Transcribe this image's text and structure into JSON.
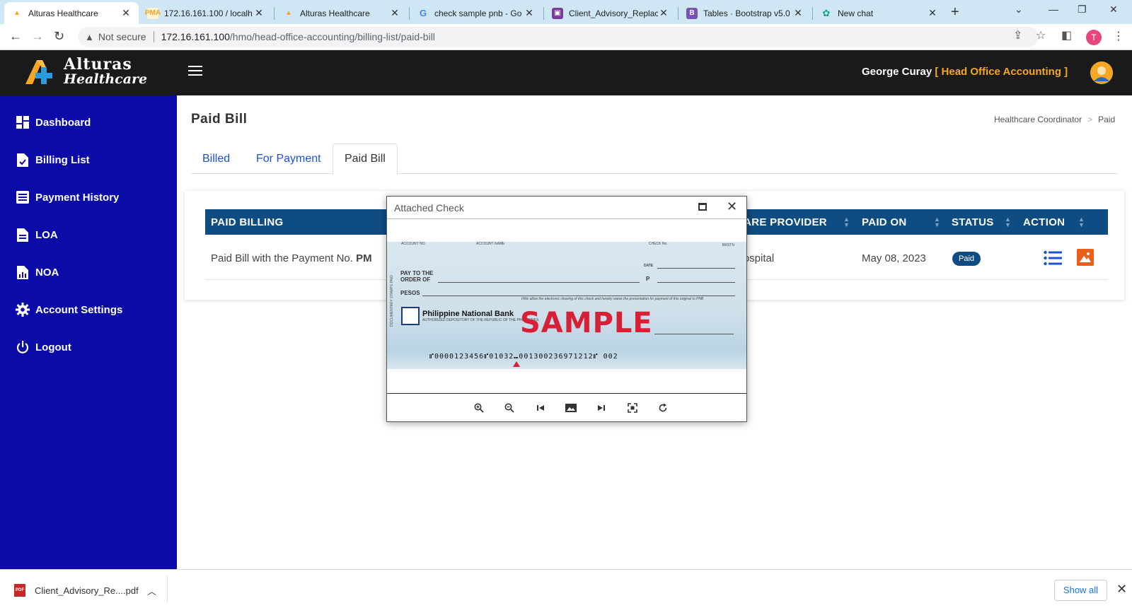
{
  "browser": {
    "tabs": [
      {
        "title": "Alturas Healthcare",
        "active": true
      },
      {
        "title": "172.16.161.100 / localh",
        "active": false
      },
      {
        "title": "Alturas Healthcare",
        "active": false
      },
      {
        "title": "check sample pnb - Go",
        "active": false
      },
      {
        "title": "Client_Advisory_Replac",
        "active": false
      },
      {
        "title": "Tables · Bootstrap v5.0",
        "active": false
      },
      {
        "title": "New chat",
        "active": false
      }
    ],
    "not_secure_label": "Not secure",
    "url_host": "172.16.161.100",
    "url_path": "/hmo/head-office-accounting/billing-list/paid-bill",
    "profile_initial": "T"
  },
  "header": {
    "logo_line1": "Alturas",
    "logo_line2": "Healthcare",
    "user_name": "George Curay",
    "user_role": "[ Head Office Accounting ]",
    "colors": {
      "header_bg": "#1a1a1a",
      "role_color": "#f5a623"
    }
  },
  "sidebar": {
    "bg_color": "#0b0ca8",
    "items": [
      {
        "label": "Dashboard",
        "icon": "dashboard-icon"
      },
      {
        "label": "Billing List",
        "icon": "file-check-icon"
      },
      {
        "label": "Payment History",
        "icon": "list-doc-icon"
      },
      {
        "label": "LOA",
        "icon": "document-icon"
      },
      {
        "label": "NOA",
        "icon": "document-chart-icon"
      },
      {
        "label": "Account Settings",
        "icon": "gear-icon"
      },
      {
        "label": "Logout",
        "icon": "power-icon"
      }
    ]
  },
  "page": {
    "title": "Paid Bill",
    "breadcrumb": [
      "Healthcare Coordinator",
      "Paid"
    ],
    "tabs": [
      {
        "label": "Billed",
        "active": false
      },
      {
        "label": "For Payment",
        "active": false
      },
      {
        "label": "Paid Bill",
        "active": true
      }
    ]
  },
  "table": {
    "columns": [
      "PAID BILLING",
      "CARE PROVIDER",
      "PAID ON",
      "STATUS",
      "ACTION"
    ],
    "rows": [
      {
        "paid_billing_prefix": "Paid Bill with the Payment No. ",
        "paid_billing_no": "PM",
        "care_provider": "Hospital",
        "paid_on": "May 08, 2023",
        "status": "Paid"
      }
    ]
  },
  "modal": {
    "title": "Attached Check",
    "check": {
      "account_no_label": "ACCOUNT NO.",
      "account_name_label": "ACCOUNT NAME",
      "check_no_label": "CHECK No.",
      "brstn_label": "BRSTN",
      "pay_to_label_1": "PAY TO THE",
      "pay_to_label_2": "ORDER OF",
      "pesos_label": "PESOS",
      "date_label": "DATE",
      "peso_sign": "P",
      "bank_name": "Philippine National Bank",
      "bank_subtitle": "AUTHORIZED DEPOSITORY OF THE REPUBLIC OF THE PHILIPPINES",
      "side_text": "DOCUMENTARY STAMPS PAID",
      "clearing_note": "I/We allow the electronic clearing of this check and hereby waive the presentation for payment of this original to PNB",
      "watermark": "SAMPLE",
      "micr_line": "⑈0000123456⑈01032⑉001300236971212⑈ 002"
    },
    "toolbar": [
      "zoom-in-icon",
      "zoom-out-icon",
      "first-icon",
      "image-icon",
      "last-icon",
      "fullscreen-icon",
      "rotate-icon"
    ]
  },
  "downloads": {
    "file_name": "Client_Advisory_Re....pdf",
    "file_type": "PDF",
    "show_all_label": "Show all"
  }
}
